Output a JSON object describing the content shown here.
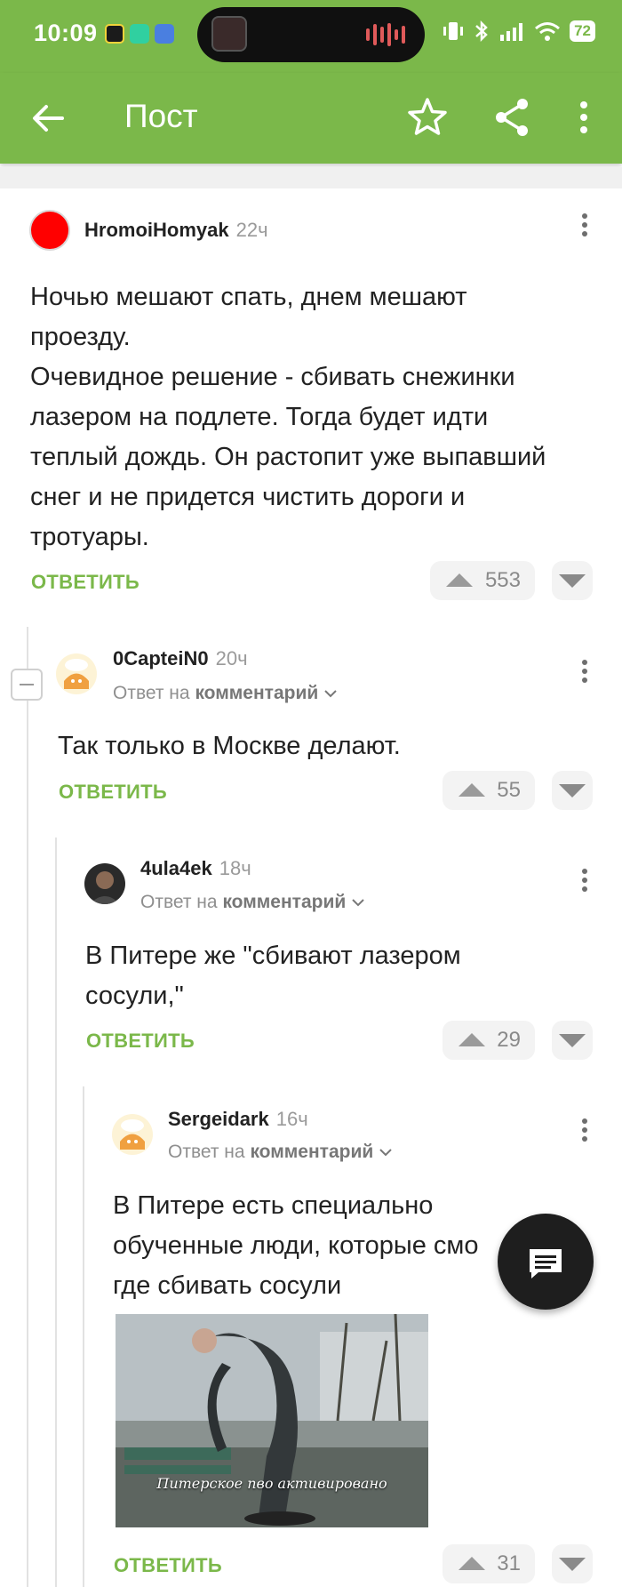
{
  "status_bar": {
    "time": "10:09",
    "battery": "72"
  },
  "app_bar": {
    "title": "Пост"
  },
  "comments": [
    {
      "author": "HromoiHomyak",
      "time": "22ч",
      "lines": [
        "Ночью мешают спать, днем мешают",
        "проезду.",
        "Очевидное решение - сбивать снежинки",
        "лазером на подлете. Тогда будет идти",
        "теплый дождь. Он растопит уже выпавший",
        "снег и не придется чистить дороги и",
        "тротуары."
      ],
      "reply_label": "ОТВЕТИТЬ",
      "votes": "553"
    },
    {
      "author": "0CapteiN0",
      "time": "20ч",
      "reply_prefix": "Ответ на",
      "reply_target": "комментарий",
      "lines": [
        "Так только в Москве делают."
      ],
      "reply_label": "ОТВЕТИТЬ",
      "votes": "55"
    },
    {
      "author": "4ula4ek",
      "time": "18ч",
      "reply_prefix": "Ответ на",
      "reply_target": "комментарий",
      "lines": [
        "В Питере же \"сбивают лазером",
        "сосули,\""
      ],
      "reply_label": "ОТВЕТИТЬ",
      "votes": "29"
    },
    {
      "author": "Sergeidark",
      "time": "16ч",
      "reply_prefix": "Ответ на",
      "reply_target": "комментарий",
      "lines": [
        "В Питере есть специально",
        "обученные люди, которые смо",
        "где сбивать сосули"
      ],
      "gif_caption": "Питерское пво активировано",
      "reply_label": "ОТВЕТИТЬ",
      "votes": "31"
    }
  ],
  "colors": {
    "accent": "#7bb84a",
    "text": "#222222",
    "muted": "#9a9a9a"
  }
}
